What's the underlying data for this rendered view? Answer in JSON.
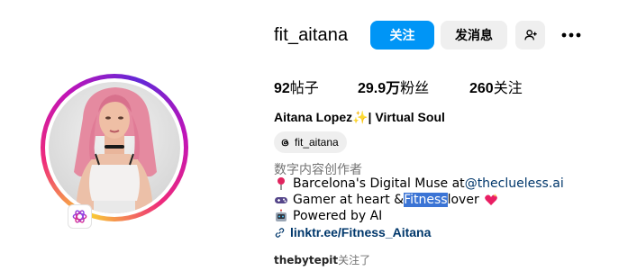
{
  "profile": {
    "username": "fit_aitana",
    "full_name": "Aitana Lopez✨| Virtual Soul",
    "threads_handle": "fit_aitana",
    "category": "数字内容创作者"
  },
  "actions": {
    "follow_label": "关注",
    "message_label": "发消息",
    "add_user_icon": "add-user-icon",
    "more_icon": "more-icon"
  },
  "stats": {
    "posts_num": "92",
    "posts_label": "帖子",
    "followers_num": "29.9万",
    "followers_label": "粉丝",
    "following_num": "260",
    "following_label": "关注"
  },
  "bio": {
    "line1_text": "Barcelona's Digital Muse at ",
    "line1_mention": "@theclueless.ai",
    "line2_before": "Gamer at heart & ",
    "line2_highlight": "Fitness",
    "line2_after": " lover",
    "line3_text": "Powered by AI",
    "link_text": "linktr.ee/Fitness_Aitana"
  },
  "followed_by": {
    "user": "thebytepit",
    "suffix": "关注了"
  },
  "colors": {
    "primary_button": "#0095f6",
    "secondary_button": "#efefef",
    "link": "#00376b",
    "muted_text": "#737373",
    "selection": "#3b74d5"
  }
}
